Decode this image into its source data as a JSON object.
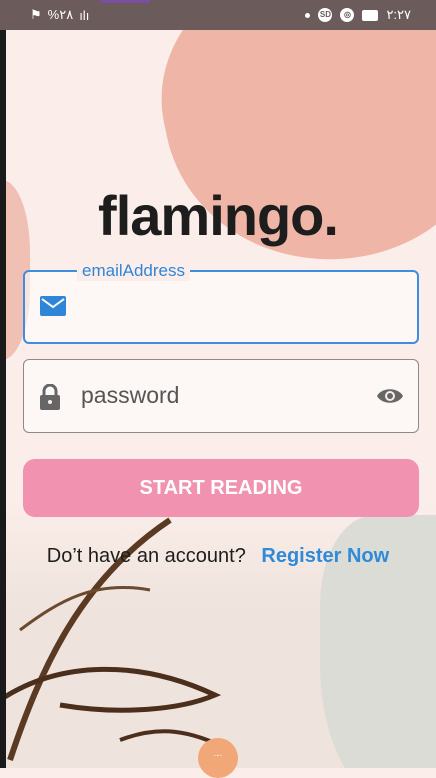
{
  "status_bar": {
    "left_battery": "%٢٨",
    "time": "٢:٢٧",
    "sd_label": "SD"
  },
  "app": {
    "logo": "flamingo."
  },
  "form": {
    "email_label": "emailAddress",
    "password_placeholder": "password",
    "submit_label": "START READING"
  },
  "register": {
    "question": "Do’t have an account?",
    "link": "Register Now"
  },
  "home_indicator": "·-·",
  "colors": {
    "accent_blue": "#2f86d8",
    "button_pink": "#f192b0",
    "blob_salmon": "#efb5a6"
  },
  "icons": {
    "email": "mail-icon",
    "password": "lock-icon",
    "toggle": "eye-icon"
  }
}
